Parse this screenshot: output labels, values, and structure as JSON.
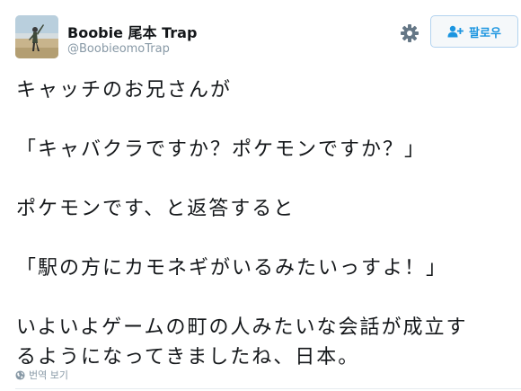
{
  "user": {
    "display_name": "Boobie 尾本 Trap",
    "handle": "@BoobieomoTrap"
  },
  "follow_button": {
    "label": "팔로우",
    "icon": "add-user-icon"
  },
  "settings": {
    "icon": "gear-icon"
  },
  "tweet": {
    "lines": [
      "キャッチのお兄さんが",
      "「キャバクラですか？ポケモンですか？」",
      "ポケモンです、と返答すると",
      "「駅の方にカモネギがいるみたいっすよ！」",
      "いよいよゲームの町の人みたいな会話が成立す",
      "るようになってきましたね、日本。"
    ]
  },
  "translate": {
    "label": "번역 보기",
    "icon": "globe-icon"
  },
  "colors": {
    "primary_text": "#14171a",
    "secondary_text": "#8899a6",
    "accent": "#1b95e0",
    "button_border": "#b3d3ef",
    "button_bg": "#f5f8fa"
  }
}
